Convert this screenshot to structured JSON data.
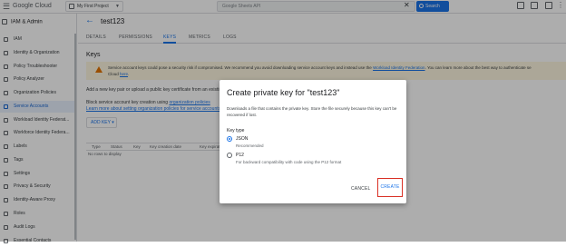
{
  "topbar": {
    "logo_text": "Google Cloud",
    "project": "My First Project",
    "search_value": "Google Sheets API",
    "search_button": "Search"
  },
  "sidebar": {
    "header": "IAM & Admin",
    "items": [
      {
        "label": "IAM"
      },
      {
        "label": "Identity & Organization"
      },
      {
        "label": "Policy Troubleshooter"
      },
      {
        "label": "Policy Analyzer"
      },
      {
        "label": "Organization Policies"
      },
      {
        "label": "Service Accounts"
      },
      {
        "label": "Workload Identity Federat..."
      },
      {
        "label": "Workforce Identity Federa..."
      },
      {
        "label": "Labels"
      },
      {
        "label": "Tags"
      },
      {
        "label": "Settings"
      },
      {
        "label": "Privacy & Security"
      },
      {
        "label": "Identity-Aware Proxy"
      },
      {
        "label": "Roles"
      },
      {
        "label": "Audit Logs"
      },
      {
        "label": "Essential Contacts"
      }
    ]
  },
  "page": {
    "title": "test123",
    "tabs": [
      {
        "label": "DETAILS"
      },
      {
        "label": "PERMISSIONS"
      },
      {
        "label": "KEYS"
      },
      {
        "label": "METRICS"
      },
      {
        "label": "LOGS"
      }
    ],
    "keys_heading": "Keys",
    "warning_text": "Service account keys could pose a security risk if compromised. We recommend you avoid downloading service account keys and instead use the",
    "warning_link": "Workload Identity Federation",
    "warning_tail": ". You can learn more about the best way to authenticate se",
    "warning_line2": "Cloud",
    "warning_here": "here",
    "add_text": "Add a new key pair or upload a public key certificate from an existing",
    "block_text": "Block service account key creation using",
    "block_link": "organization policies",
    "learn_link": "Learn more about setting organization policies for service accounts",
    "add_key_label": "ADD KEY",
    "table_headers": [
      "Type",
      "Status",
      "Key",
      "Key creation date",
      "Key expiration"
    ],
    "no_rows": "No rows to display"
  },
  "dialog": {
    "title": "Create private key for \"test123\"",
    "description": "Downloads a file that contains the private key. Store the file securely because this key can't be recovered if lost.",
    "key_type_label": "Key type",
    "options": [
      {
        "label": "JSON",
        "help": "Recommended",
        "selected": true
      },
      {
        "label": "P12",
        "help": "For backward compatibility with code using the P12 format",
        "selected": false
      }
    ],
    "cancel_label": "CANCEL",
    "create_label": "CREATE"
  },
  "colors": {
    "accent": "#1a73e8",
    "highlight_border": "#d93025",
    "warning_icon": "#e37400"
  }
}
